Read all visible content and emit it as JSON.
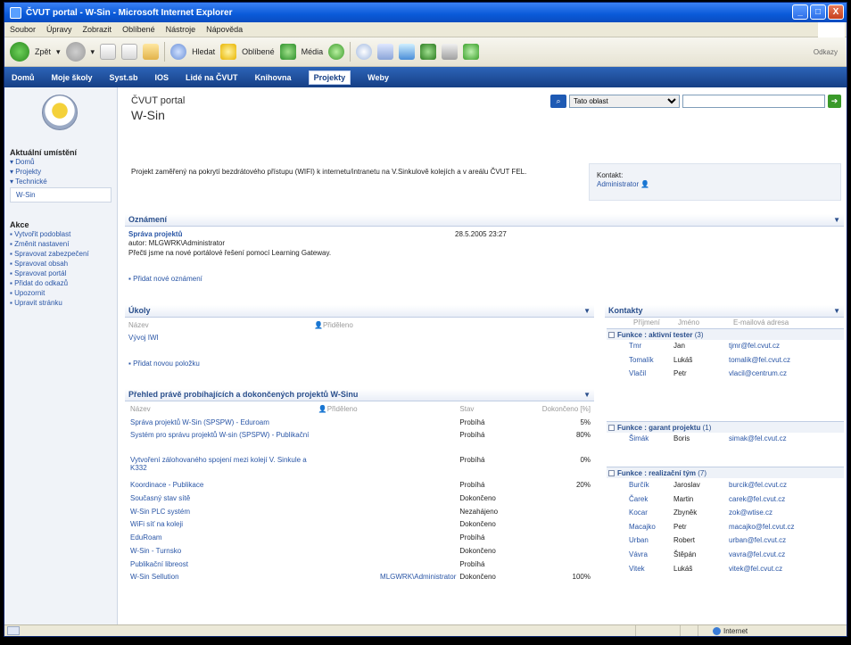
{
  "window": {
    "title": "ČVUT portal - W-Sin - Microsoft Internet Explorer",
    "buttons": {
      "min": "_",
      "max": "□",
      "close": "X"
    }
  },
  "menu": [
    "Soubor",
    "Úpravy",
    "Zobrazit",
    "Oblíbené",
    "Nástroje",
    "Nápověda"
  ],
  "toolbar": {
    "back_label": "Zpět",
    "search_label": "Hledat",
    "favorites_label": "Oblíbené",
    "media_label": "Média",
    "links_label": "Odkazy"
  },
  "nav": [
    "Domů",
    "Moje školy",
    "Syst.sb",
    "IOS",
    "Lidé na ČVUT",
    "Knihovna",
    "Projekty",
    "Weby"
  ],
  "nav_active_index": 6,
  "sidebar": {
    "section1": "Aktuální umístění",
    "loc_items": [
      "Domů",
      "Projekty",
      "Technické"
    ],
    "current": "W-Sin",
    "section2": "Akce",
    "actions": [
      "Vytvořit podoblast",
      "Změnit nastavení",
      "Spravovat zabezpečení",
      "Spravovat obsah",
      "Spravovat portál",
      "Přidat do odkazů",
      "Upozornit",
      "Upravit stránku"
    ]
  },
  "page": {
    "title_small": "ČVUT portal",
    "title_large": "W-Sin",
    "search_scope": "Tato oblast",
    "search_value": "",
    "description": "Projekt zaměřený na pokrytí bezdrátového přístupu (WIFI) k internetu/intranetu na V.Sinkulově kolejích a v areálu ČVUT FEL.",
    "contact_label": "Kontakt:",
    "contact_name": "Administrator"
  },
  "oznameni": {
    "title": "Oznámení",
    "item_title": "Správa projektů",
    "item_date": "28.5.2005 23:27",
    "item_author": "autor: MLGWRK\\Administrator",
    "item_body": "Přečti jsme na nové portálové řešení pomocí Learning Gateway.",
    "add": "Přidat nové oznámení"
  },
  "ukoly": {
    "title": "Úkoly",
    "col_name": "Název",
    "col_assigned": "Přiděleno",
    "rows": [
      "Vývoj IWI"
    ],
    "add": "Přidat novou položku"
  },
  "projects": {
    "title": "Přehled právě probíhajících a dokončených projektů W-Sinu",
    "cols": [
      "Název",
      "Přiděleno",
      "Stav",
      "Dokončeno [%]"
    ],
    "rows": [
      {
        "name": "Správa projektů W-Sin (SPSPW) - Eduroam",
        "assigned": "",
        "state": "Probíhá",
        "pct": "5%"
      },
      {
        "name": "Systém pro správu projektů W-sin (SPSPW) - Publikační",
        "assigned": "",
        "state": "Probíhá",
        "pct": "80%"
      },
      {
        "name": "Vytvoření zálohovaného spojení mezi kolejí V. Sinkule a K332",
        "assigned": "",
        "state": "Probíhá",
        "pct": "0%"
      },
      {
        "name": "Koordinace - Publikace",
        "assigned": "",
        "state": "Probíhá",
        "pct": "20%"
      },
      {
        "name": "Současný stav sítě",
        "assigned": "",
        "state": "Dokončeno",
        "pct": ""
      },
      {
        "name": "W-Sin PLC systém",
        "assigned": "",
        "state": "Nezahájeno",
        "pct": ""
      },
      {
        "name": "WiFi síť na koleji",
        "assigned": "",
        "state": "Dokončeno",
        "pct": ""
      },
      {
        "name": "EduRoam",
        "assigned": "",
        "state": "Probíhá",
        "pct": ""
      },
      {
        "name": "W-Sin - Turnsko",
        "assigned": "",
        "state": "Dokončeno",
        "pct": ""
      },
      {
        "name": "Publikační libreost",
        "assigned": "",
        "state": "Probíhá",
        "pct": ""
      },
      {
        "name": "W-Sin Sellution",
        "assigned": "MLGWRK\\Administrator",
        "state": "Dokončeno",
        "pct": "100%"
      }
    ]
  },
  "contacts": {
    "title": "Kontakty",
    "cols": [
      "Příjmení",
      "Jméno",
      "E-mailová adresa"
    ],
    "groups": [
      {
        "label": "Funkce : aktivní tester",
        "count": "(3)",
        "rows": [
          {
            "last": "Tmr",
            "first": "Jan",
            "email": "tjmr@fel.cvut.cz"
          },
          {
            "last": "Tomalík",
            "first": "Lukáš",
            "email": "tomalik@fel.cvut.cz"
          },
          {
            "last": "Vlačil",
            "first": "Petr",
            "email": "vlacil@centrum.cz"
          }
        ]
      },
      {
        "label": "Funkce : garant projektu",
        "count": "(1)",
        "rows": [
          {
            "last": "Šimák",
            "first": "Boris",
            "email": "simak@fel.cvut.cz"
          }
        ]
      },
      {
        "label": "Funkce : realizační tým",
        "count": "(7)",
        "rows": [
          {
            "last": "Burčík",
            "first": "Jaroslav",
            "email": "burcik@fel.cvut.cz"
          },
          {
            "last": "Čarek",
            "first": "Martin",
            "email": "carek@fel.cvut.cz"
          },
          {
            "last": "Kocar",
            "first": "Zbyněk",
            "email": "zok@wtise.cz"
          },
          {
            "last": "Macajko",
            "first": "Petr",
            "email": "macajko@fel.cvut.cz"
          },
          {
            "last": "Urban",
            "first": "Robert",
            "email": "urban@fel.cvut.cz"
          },
          {
            "last": "Vávra",
            "first": "Štěpán",
            "email": "vavra@fel.cvut.cz"
          },
          {
            "last": "Vitek",
            "first": "Lukáš",
            "email": "vitek@fel.cvut.cz"
          }
        ]
      }
    ]
  },
  "status": {
    "zone": "Internet"
  },
  "colors": {
    "nav_bg": "#1e4a95",
    "link": "#2a56a6",
    "accent": "#2a4f8c"
  }
}
